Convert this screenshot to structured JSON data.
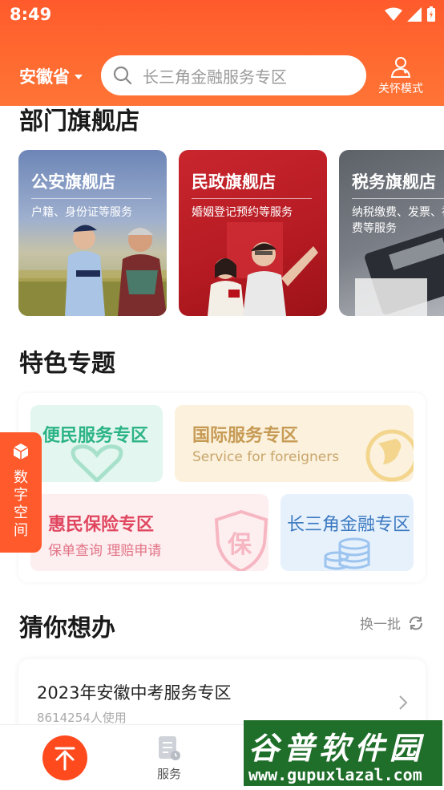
{
  "status": {
    "time": "8:49"
  },
  "header": {
    "region": "安徽省",
    "search_placeholder": "长三角金融服务专区",
    "care_mode": "关怀模式"
  },
  "flagship": {
    "title": "部门旗舰店",
    "stores": [
      {
        "name": "公安旗舰店",
        "desc": "户籍、身份证等服务"
      },
      {
        "name": "民政旗舰店",
        "desc": "婚姻登记预约等服务"
      },
      {
        "name": "税务旗舰店",
        "desc": "纳税缴费、发票、社保缴费等服务"
      }
    ]
  },
  "topics": {
    "title": "特色专题",
    "items": [
      {
        "title": "便民服务专区"
      },
      {
        "title": "国际服务专区",
        "subtitle": "Service  for foreigners"
      },
      {
        "title": "惠民保险专区",
        "subtitle": "保单查询 理赔申请",
        "badge": "保"
      },
      {
        "title": "长三角金融专区"
      }
    ]
  },
  "floating_tab": {
    "label": "数字空间"
  },
  "guess": {
    "title": "猜你想办",
    "refresh": "换一批",
    "items": [
      {
        "title": "2023年安徽中考服务专区",
        "usage": "8614254人使用"
      }
    ]
  },
  "tabbar": {
    "service": "服务"
  },
  "watermark": {
    "cn": "谷普软件园",
    "url": "www.gupuxlazal.com"
  },
  "colors": {
    "accent": "#ff5a2c",
    "topic_green": "#e3f6ef",
    "topic_yellow": "#fbf1dc",
    "topic_pink": "#fdeef0",
    "topic_blue": "#e6f1fc"
  }
}
